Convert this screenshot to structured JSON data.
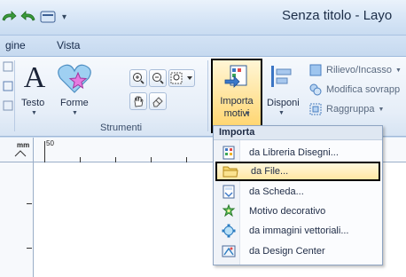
{
  "window": {
    "title": "Senza titolo - Layo",
    "qat_dropdown": "▾"
  },
  "tabs": [
    "gine",
    "Vista"
  ],
  "ribbon": {
    "text_label": "Testo",
    "shapes_label": "Forme",
    "tools_group_label": "Strumenti",
    "import_label_line1": "Importa",
    "import_label_line2": "motivi",
    "arrange_label": "Disponi",
    "relief_label": "Rilievo/Incasso",
    "edit_overlap_label": "Modifica sovrapp",
    "group_label": "Raggruppa"
  },
  "ruler": {
    "unit": "mm",
    "label_50": "50"
  },
  "menu": {
    "header": "Importa",
    "items": [
      {
        "label": "da Libreria Disegni...",
        "icon": "library-icon"
      },
      {
        "label": "da File...",
        "icon": "folder-icon",
        "selected": true
      },
      {
        "label": "da Scheda...",
        "icon": "card-icon"
      },
      {
        "label": "Motivo decorativo",
        "icon": "decorative-pattern-icon"
      },
      {
        "label": "da immagini vettoriali...",
        "icon": "vector-image-icon"
      },
      {
        "label": "da Design Center",
        "icon": "design-center-icon"
      }
    ]
  },
  "colors": {
    "accent": "#ffe39a",
    "highlight_border": "#000000",
    "ribbon_bg": "#e6eef8"
  }
}
